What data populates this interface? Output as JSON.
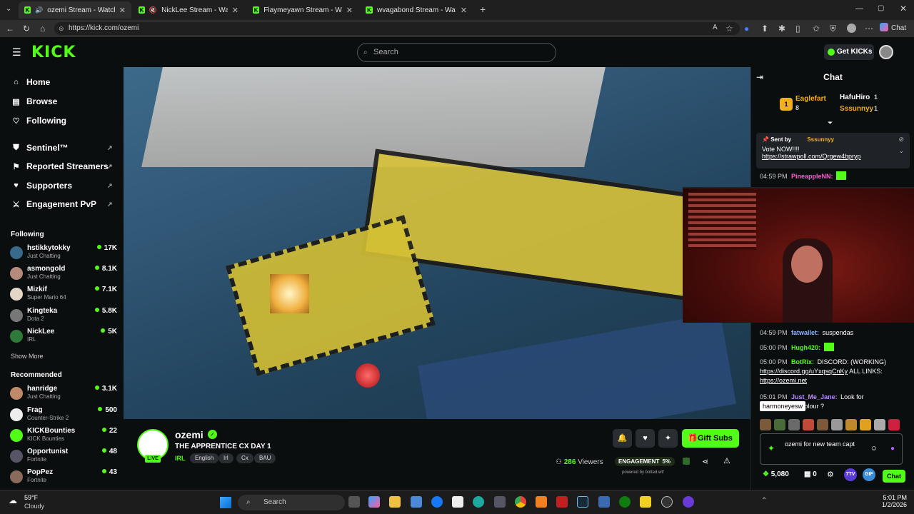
{
  "browser": {
    "tabs": [
      {
        "title": "ozemi Stream - Watch Live o",
        "active": true
      },
      {
        "title": "NickLee Stream - Watch Live o"
      },
      {
        "title": "Flaymeyawn Stream - Watch Live o"
      },
      {
        "title": "wvagabond Stream - Watch Li"
      }
    ],
    "url": "https://kick.com/ozemi",
    "chat_button": "Chat"
  },
  "header": {
    "logo": "KICK",
    "search_placeholder": "Search",
    "get_kicks": "Get KICKs"
  },
  "sidebar": {
    "nav": [
      {
        "label": "Home",
        "icon": "home-icon"
      },
      {
        "label": "Browse",
        "icon": "browse-icon"
      },
      {
        "label": "Following",
        "icon": "heart-icon"
      }
    ],
    "tools": [
      {
        "label": "Sentinel™",
        "icon": "shield-icon"
      },
      {
        "label": "Reported Streamers",
        "icon": "flag-icon"
      },
      {
        "label": "Supporters",
        "icon": "heart-icon"
      },
      {
        "label": "Engagement PvP",
        "icon": "swords-icon"
      }
    ],
    "following_heading": "Following",
    "following": [
      {
        "name": "hstikkytokky",
        "category": "Just Chatting",
        "viewers": "17K"
      },
      {
        "name": "asmongold",
        "category": "Just Chatting",
        "viewers": "8.1K"
      },
      {
        "name": "Mizkif",
        "category": "Super Mario 64",
        "viewers": "7.1K"
      },
      {
        "name": "Kingteka",
        "category": "Dota 2",
        "viewers": "5.8K"
      },
      {
        "name": "NickLee",
        "category": "IRL",
        "viewers": "5K"
      }
    ],
    "show_more": "Show More",
    "recommended_heading": "Recommended",
    "recommended": [
      {
        "name": "hanridge",
        "category": "Just Chatting",
        "viewers": "3.1K"
      },
      {
        "name": "Frag",
        "category": "Counter-Strike 2",
        "viewers": "500"
      },
      {
        "name": "KICKBounties",
        "category": "KICK Bounties",
        "viewers": "22"
      },
      {
        "name": "Opportunist",
        "category": "Fortnite",
        "viewers": "48"
      },
      {
        "name": "PopPez",
        "category": "Fortnite",
        "viewers": "43"
      }
    ]
  },
  "stream": {
    "channel": "ozemi",
    "title": "THE APPRENTICE CX DAY 1",
    "live": "LIVE",
    "category": "IRL",
    "tags": [
      "English",
      "Irl",
      "Cx",
      "BAU"
    ],
    "gift_subs": "Gift Subs",
    "viewers": "286",
    "viewers_label": "Viewers",
    "engagement_label": "ENGAGEMENT",
    "engagement_pct": "5%",
    "powered_by": "powered by botted.wtf"
  },
  "chat": {
    "title": "Chat",
    "leaderboard": [
      {
        "name": "Eaglefart",
        "value": "8"
      },
      {
        "name": "HafuHiro",
        "value": "1"
      },
      {
        "name": "Sssunnyy",
        "value": "1"
      }
    ],
    "pinned": {
      "sent_by_label": "Sent by",
      "sent_by_user": "Sssunnyy",
      "text": "Vote NOW!!!!",
      "link": "https://strawpoll.com/Qrgew4bpryp"
    },
    "messages": [
      {
        "time": "04:59 PM",
        "user": "PineappleNN:",
        "color": "#ff5ccf",
        "text": ""
      },
      {
        "time": "04:59 PM",
        "user": "fatwallet:",
        "color": "#8fb3ff",
        "text": "suspendas"
      },
      {
        "time": "05:00 PM",
        "user": "Hugh420:",
        "color": "#53fc18",
        "text": ""
      },
      {
        "time": "05:00 PM",
        "user": "BotRix:",
        "color": "#53fc18",
        "text": "DISCORD: (WORKING)",
        "link": "https://discord.gg/uYxqsqCnKy",
        "after": "ALL LINKS:",
        "link2": "https://ozemi.net"
      },
      {
        "time": "05:01 PM",
        "user": "Just_Me_Jane:",
        "color": "#b98cff",
        "text": "Look for",
        "text2": "colour ?"
      }
    ],
    "tooltip": "harmoneyesw",
    "input_text": "ozemi for new team capt",
    "points": "5,080",
    "count": "0",
    "chat_button": "Chat"
  },
  "taskbar": {
    "weather_temp": "59°F",
    "weather_desc": "Cloudy",
    "search": "Search",
    "time": "5:01 PM",
    "date": "1/2/2026"
  },
  "colors": {
    "accent": "#53fc18",
    "background": "#0b0e0f"
  }
}
